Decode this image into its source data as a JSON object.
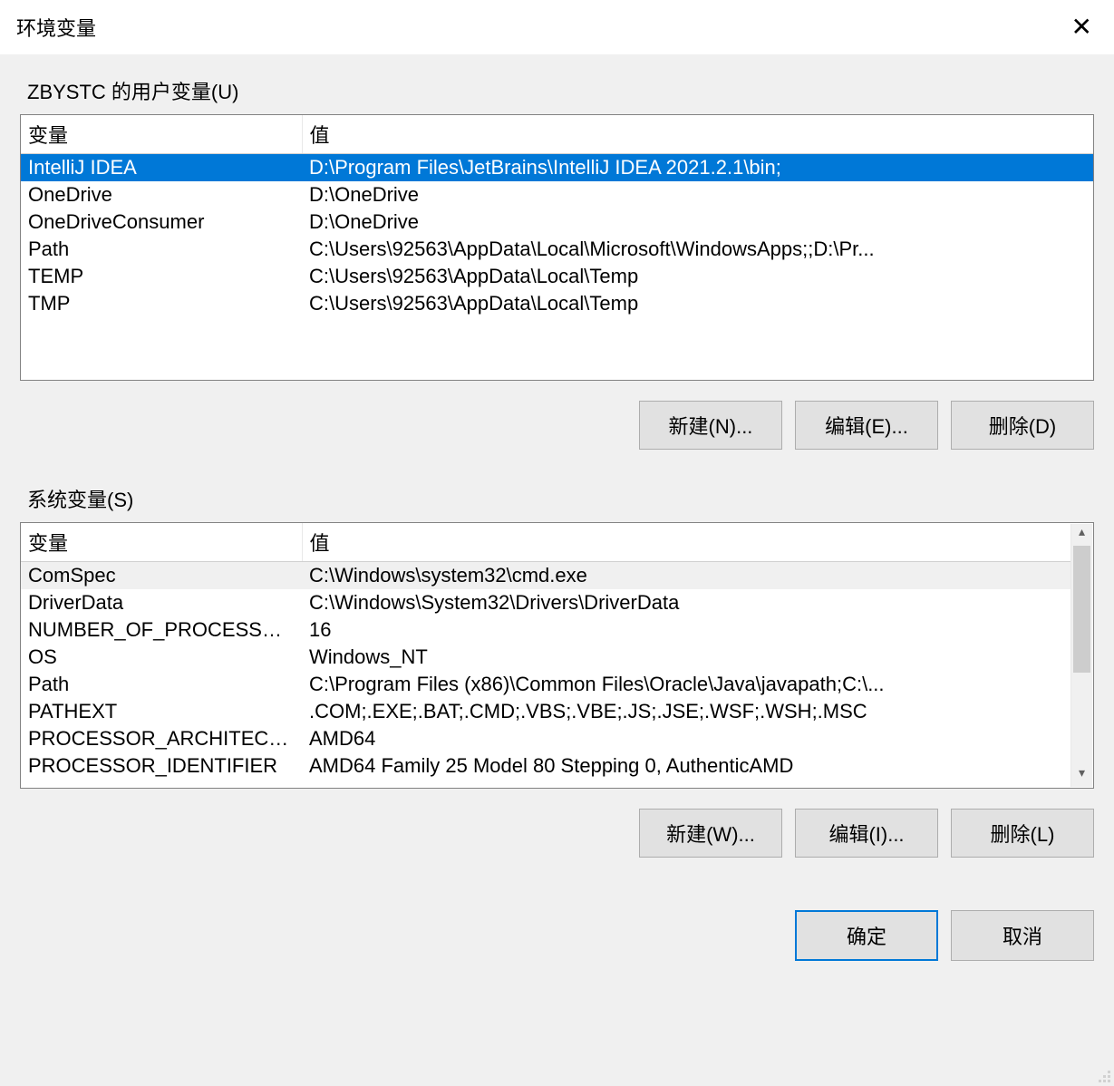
{
  "title": "环境变量",
  "userSection": {
    "label": "ZBYSTC 的用户变量(U)",
    "columns": {
      "variable": "变量",
      "value": "值"
    },
    "rows": [
      {
        "variable": "IntelliJ IDEA",
        "value": "D:\\Program Files\\JetBrains\\IntelliJ IDEA 2021.2.1\\bin;",
        "selected": true
      },
      {
        "variable": "OneDrive",
        "value": "D:\\OneDrive"
      },
      {
        "variable": "OneDriveConsumer",
        "value": "D:\\OneDrive"
      },
      {
        "variable": "Path",
        "value": "C:\\Users\\92563\\AppData\\Local\\Microsoft\\WindowsApps;;D:\\Pr..."
      },
      {
        "variable": "TEMP",
        "value": "C:\\Users\\92563\\AppData\\Local\\Temp"
      },
      {
        "variable": "TMP",
        "value": "C:\\Users\\92563\\AppData\\Local\\Temp"
      }
    ],
    "buttons": {
      "new": "新建(N)...",
      "edit": "编辑(E)...",
      "delete": "删除(D)"
    }
  },
  "systemSection": {
    "label": "系统变量(S)",
    "columns": {
      "variable": "变量",
      "value": "值"
    },
    "rows": [
      {
        "variable": "ComSpec",
        "value": "C:\\Windows\\system32\\cmd.exe",
        "highlighted": true
      },
      {
        "variable": "DriverData",
        "value": "C:\\Windows\\System32\\Drivers\\DriverData"
      },
      {
        "variable": "NUMBER_OF_PROCESSORS",
        "value": "16"
      },
      {
        "variable": "OS",
        "value": "Windows_NT"
      },
      {
        "variable": "Path",
        "value": "C:\\Program Files (x86)\\Common Files\\Oracle\\Java\\javapath;C:\\..."
      },
      {
        "variable": "PATHEXT",
        "value": ".COM;.EXE;.BAT;.CMD;.VBS;.VBE;.JS;.JSE;.WSF;.WSH;.MSC"
      },
      {
        "variable": "PROCESSOR_ARCHITECTU...",
        "value": "AMD64"
      },
      {
        "variable": "PROCESSOR_IDENTIFIER",
        "value": "AMD64 Family 25 Model 80 Stepping 0, AuthenticAMD"
      }
    ],
    "buttons": {
      "new": "新建(W)...",
      "edit": "编辑(I)...",
      "delete": "删除(L)"
    }
  },
  "dialogButtons": {
    "ok": "确定",
    "cancel": "取消"
  }
}
